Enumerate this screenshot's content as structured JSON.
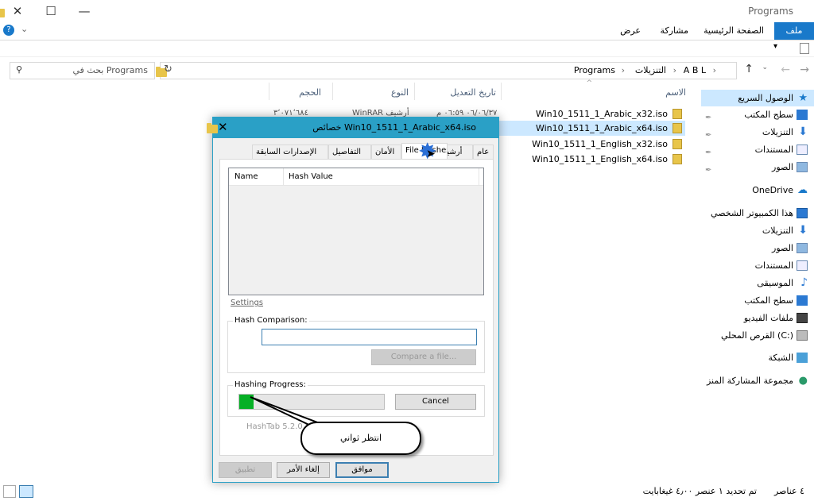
{
  "window": {
    "title": "Programs"
  },
  "ribbon": {
    "tabs": [
      "ملف",
      "الصفحة الرئيسية",
      "مشاركة",
      "عرض"
    ],
    "file_tab_color": "#1979ca"
  },
  "address": {
    "crumbs": [
      "A B L",
      "التنزيلات",
      "Programs"
    ],
    "search_placeholder": "بحث في Programs"
  },
  "columns": {
    "name": "الاسم",
    "date": "تاريخ التعديل",
    "type": "النوع",
    "size": "الحجم"
  },
  "files": [
    {
      "name": "Win10_1511_1_Arabic_x32.iso",
      "date": "٠٦/٠٦/٣٧ ٠٦:٥٩ م",
      "type": "WinRAR أرشيف",
      "size": "٣٬٠٧١٬٦٨٤"
    },
    {
      "name": "Win10_1511_1_Arabic_x64.iso"
    },
    {
      "name": "Win10_1511_1_English_x32.iso"
    },
    {
      "name": "Win10_1511_1_English_x64.iso"
    }
  ],
  "nav": {
    "quick_access": "الوصول السريع",
    "quick_items": [
      "سطح المكتب",
      "التنزيلات",
      "المستندات",
      "الصور"
    ],
    "onedrive": "OneDrive",
    "this_pc": "هذا الكمبيوتر الشخصي",
    "pc_items": [
      "التنزيلات",
      "الصور",
      "المستندات",
      "الموسيقى",
      "سطح المكتب",
      "ملفات الفيديو",
      "القرص المحلي (C:)"
    ],
    "network": "الشبكة",
    "homegroup": "مجموعة المشاركة المنز"
  },
  "status": {
    "count": "٤ عناصر",
    "selected": "تم تحديد ١ عنصر ٤٫٠٠ غيغابايت"
  },
  "dialog": {
    "title": "خصائص Win10_1511_1_Arabic_x64.iso",
    "tabs": [
      "عام",
      "أرشيف",
      "File Hashes",
      "الأمان",
      "التفاصيل",
      "الإصدارات السابقة"
    ],
    "list_headers": [
      "Name",
      "Hash Value"
    ],
    "settings_link": "Settings",
    "hash_comparison_label": "Hash Comparison:",
    "compare_button": "Compare a file...",
    "hashing_progress_label": "Hashing Progress:",
    "cancel_button": "Cancel",
    "progress": 0.1,
    "footer_text": "HashTab 5.2.0  [www.implbits.com]",
    "ok_button": "موافق",
    "cancel_ar_button": "إلغاء الأمر",
    "apply_button": "تطبيق"
  },
  "callout": {
    "text": "انتظر ثواني"
  }
}
